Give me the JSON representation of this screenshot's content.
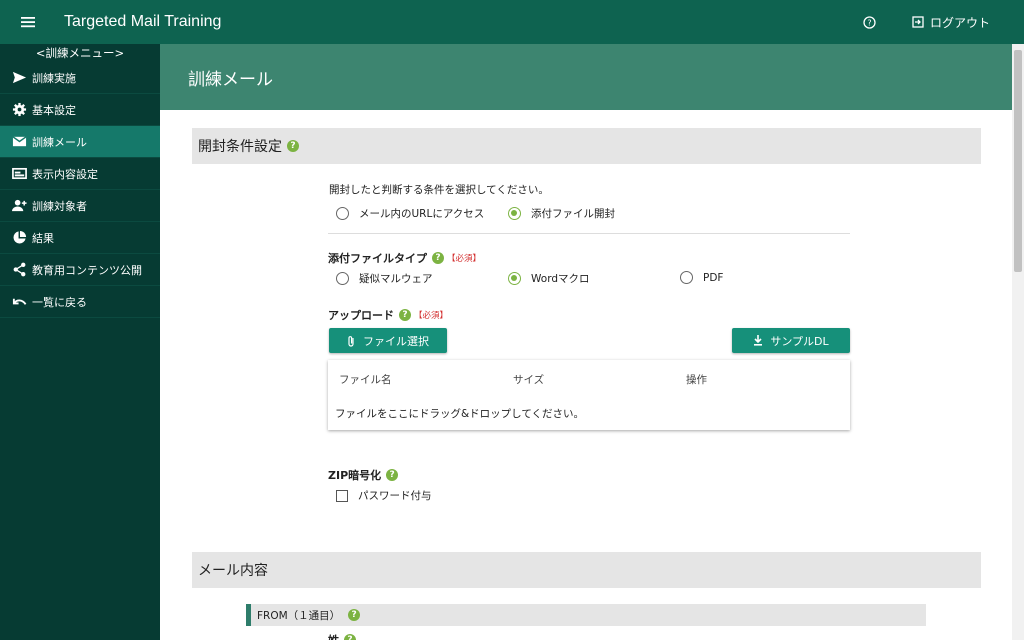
{
  "app": {
    "title": "Targeted Mail Training",
    "logout_label": "ログアウト"
  },
  "sidebar": {
    "header": "<訓練メニュー>",
    "items": [
      {
        "label": "訓練実施",
        "icon": "send-icon"
      },
      {
        "label": "基本設定",
        "icon": "gear-icon"
      },
      {
        "label": "訓練メール",
        "icon": "mail-icon",
        "active": true
      },
      {
        "label": "表示内容設定",
        "icon": "display-icon"
      },
      {
        "label": "訓練対象者",
        "icon": "add-user-icon"
      },
      {
        "label": "結果",
        "icon": "pie-chart-icon"
      },
      {
        "label": "教育用コンテンツ公開",
        "icon": "share-icon"
      },
      {
        "label": "一覧に戻る",
        "icon": "undo-icon"
      }
    ]
  },
  "page": {
    "title": "訓練メール"
  },
  "open_condition": {
    "section_title": "開封条件設定",
    "instruction": "開封したと判断する条件を選択してください。",
    "options": [
      "メール内のURLにアクセス",
      "添付ファイル開封"
    ],
    "selected_index": 1
  },
  "attachment_type": {
    "label": "添付ファイルタイプ",
    "required": "【必須】",
    "options": [
      "疑似マルウェア",
      "Wordマクロ",
      "PDF"
    ],
    "selected_index": 1
  },
  "upload": {
    "label": "アップロード",
    "required": "【必須】",
    "select_button": "ファイル選択",
    "sample_button": "サンプルDL",
    "columns": [
      "ファイル名",
      "サイズ",
      "操作"
    ],
    "drop_hint": "ファイルをここにドラッグ&ドロップしてください。"
  },
  "zip": {
    "label": "ZIP暗号化",
    "checkbox_label": "パスワード付与"
  },
  "mail_content": {
    "section_title": "メール内容",
    "from_label": "FROM（１通目）",
    "next_label": "姓"
  },
  "colors": {
    "header": "#0e6350",
    "sidebar": "#063b33",
    "accent": "#16907a",
    "help": "#7cb342"
  }
}
